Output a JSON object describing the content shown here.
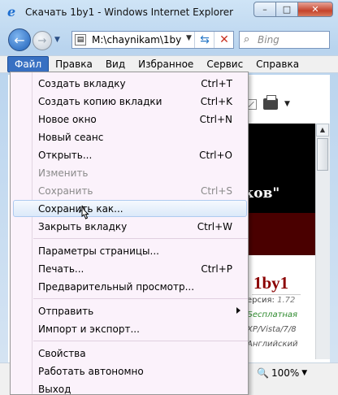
{
  "window": {
    "title": "Скачать 1by1 - Windows Internet Explorer",
    "icon": "ie-icon",
    "caption_buttons": {
      "minimize": "–",
      "maximize": "□",
      "close": "✕"
    }
  },
  "navigation": {
    "back_glyph": "←",
    "forward_glyph": "→",
    "address": "M:\\chaynikam\\1by",
    "search_placeholder": "Bing"
  },
  "menubar": {
    "items": [
      "Файл",
      "Правка",
      "Вид",
      "Избранное",
      "Сервис",
      "Справка"
    ]
  },
  "file_menu": {
    "items": [
      {
        "label": "Создать вкладку",
        "shortcut": "Ctrl+T"
      },
      {
        "label": "Создать копию вкладки",
        "shortcut": "Ctrl+K"
      },
      {
        "label": "Новое окно",
        "shortcut": "Ctrl+N"
      },
      {
        "label": "Новый сеанс",
        "shortcut": ""
      },
      {
        "label": "Открыть...",
        "shortcut": "Ctrl+O"
      },
      {
        "label": "Изменить",
        "shortcut": "",
        "disabled": true
      },
      {
        "label": "Сохранить",
        "shortcut": "Ctrl+S",
        "disabled": true
      },
      {
        "label": "Сохранить как...",
        "shortcut": "",
        "highlighted": true
      },
      {
        "label": "Закрыть вкладку",
        "shortcut": "Ctrl+W"
      },
      {
        "label": "Параметры страницы...",
        "shortcut": ""
      },
      {
        "label": "Печать...",
        "shortcut": "Ctrl+P"
      },
      {
        "label": "Предварительный просмотр...",
        "shortcut": ""
      },
      {
        "label": "Отправить",
        "shortcut": "",
        "submenu": true
      },
      {
        "label": "Импорт и экспорт...",
        "shortcut": ""
      },
      {
        "label": "Свойства",
        "shortcut": ""
      },
      {
        "label": "Работать автономно",
        "shortcut": ""
      },
      {
        "label": "Выход",
        "shortcut": ""
      }
    ]
  },
  "page": {
    "banner_text": "ков\"",
    "logo": "1by1",
    "version_label": "ерсия:",
    "version_value": "1.72",
    "license": "Бесплатная",
    "os": "XP/Vista/7/8",
    "language": "Английский",
    "zoom": "100%"
  },
  "colors": {
    "menu_bg": "#fbf2fb",
    "active_menu": "#3870c2",
    "banner": "#000000",
    "banner_strip": "#4a0000",
    "logo": "#8b0000",
    "license": "#2d8a2d"
  }
}
